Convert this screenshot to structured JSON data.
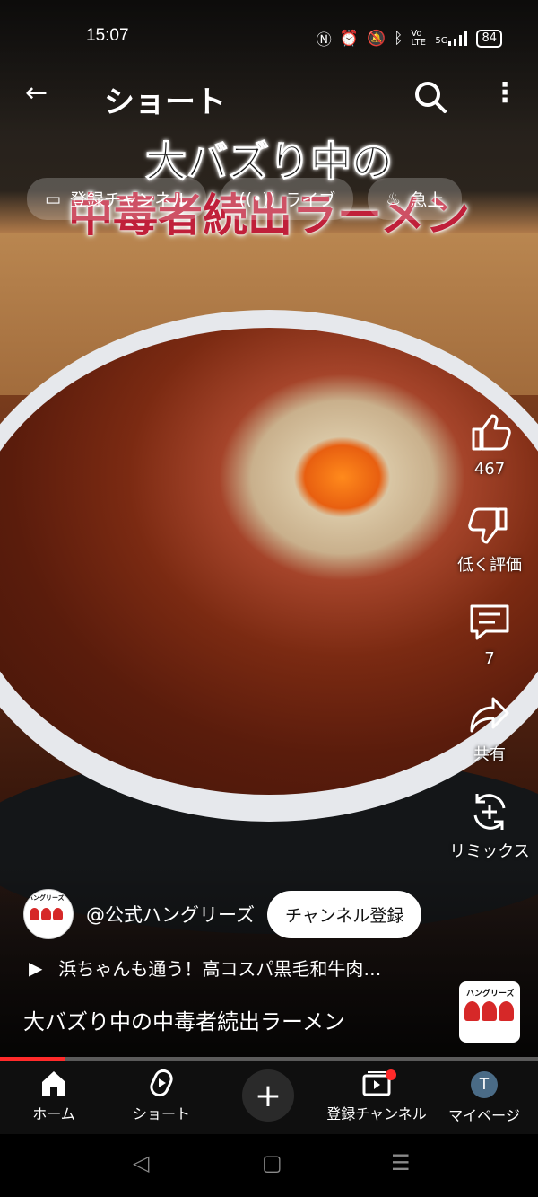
{
  "status": {
    "time": "15:07",
    "icons": [
      "nfc-icon",
      "alarm-icon",
      "mute-icon",
      "bluetooth-icon",
      "volte-icon",
      "signal-5g-icon"
    ],
    "volte": "Vo LTE",
    "network": "5G",
    "battery": "84"
  },
  "appbar": {
    "title": "ショート"
  },
  "overlay_text": {
    "line1": "大バズり中の",
    "line2": "中毒者続出ラーメン"
  },
  "chips": [
    {
      "label": "登録チャンネル",
      "icon": "subscriptions-icon"
    },
    {
      "label": "ライブ",
      "icon": "live-icon"
    },
    {
      "label": "急上",
      "icon": "trending-icon"
    }
  ],
  "actions": {
    "like": "467",
    "dislike": "低く評価",
    "comments": "7",
    "share": "共有",
    "remix": "リミックス"
  },
  "channel": {
    "logo_text": "ハングリーズ",
    "name": "@公式ハングリーズ",
    "subscribe": "チャンネル登録"
  },
  "description": "浜ちゃんも通う！高コスパ黒毛和牛肉…",
  "video_title": "大バズり中の中毒者続出ラーメン",
  "progress": 0.12,
  "nav": {
    "home": "ホーム",
    "shorts": "ショート",
    "create": "+",
    "subscriptions": "登録チャンネル",
    "you": "マイページ",
    "avatar_initial": "T"
  },
  "colors": {
    "accent": "#ff2a2a",
    "nav_bg": "#0f0f0f",
    "title_red": "#c0203a"
  }
}
